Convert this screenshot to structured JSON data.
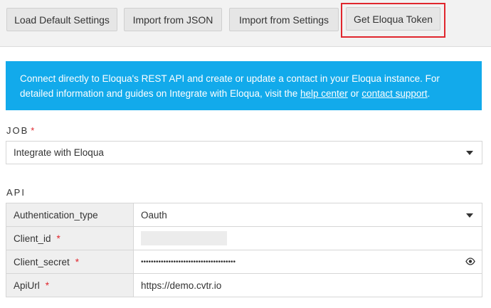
{
  "toolbar": {
    "load_default": "Load Default Settings",
    "import_json": "Import from JSON",
    "import_settings": "Import from Settings",
    "get_token": "Get Eloqua Token"
  },
  "info": {
    "text_part1": "Connect directly to Eloqua's REST API and create or update a contact in your Eloqua instance. For detailed information and guides on Integrate with Eloqua, visit the ",
    "help_link": "help center",
    "text_part2": " or ",
    "support_link": "contact support",
    "text_part3": "."
  },
  "job": {
    "label": "JOB",
    "required_mark": "*",
    "selected": "Integrate with Eloqua"
  },
  "api": {
    "label": "API",
    "rows": [
      {
        "key": "Authentication_type",
        "required": "",
        "value": "Oauth"
      },
      {
        "key": "Client_id",
        "required": "*",
        "value": ""
      },
      {
        "key": "Client_secret",
        "required": "*",
        "value": "••••••••••••••••••••••••••••••••••••••"
      },
      {
        "key": "ApiUrl",
        "required": "*",
        "value": "https://demo.cvtr.io"
      }
    ]
  },
  "colors": {
    "info_bg": "#12aaeb",
    "highlight": "#e0262d",
    "required": "#e0262d"
  },
  "icons": {
    "dropdown": "chevron-down-icon",
    "reveal": "eye-icon"
  }
}
